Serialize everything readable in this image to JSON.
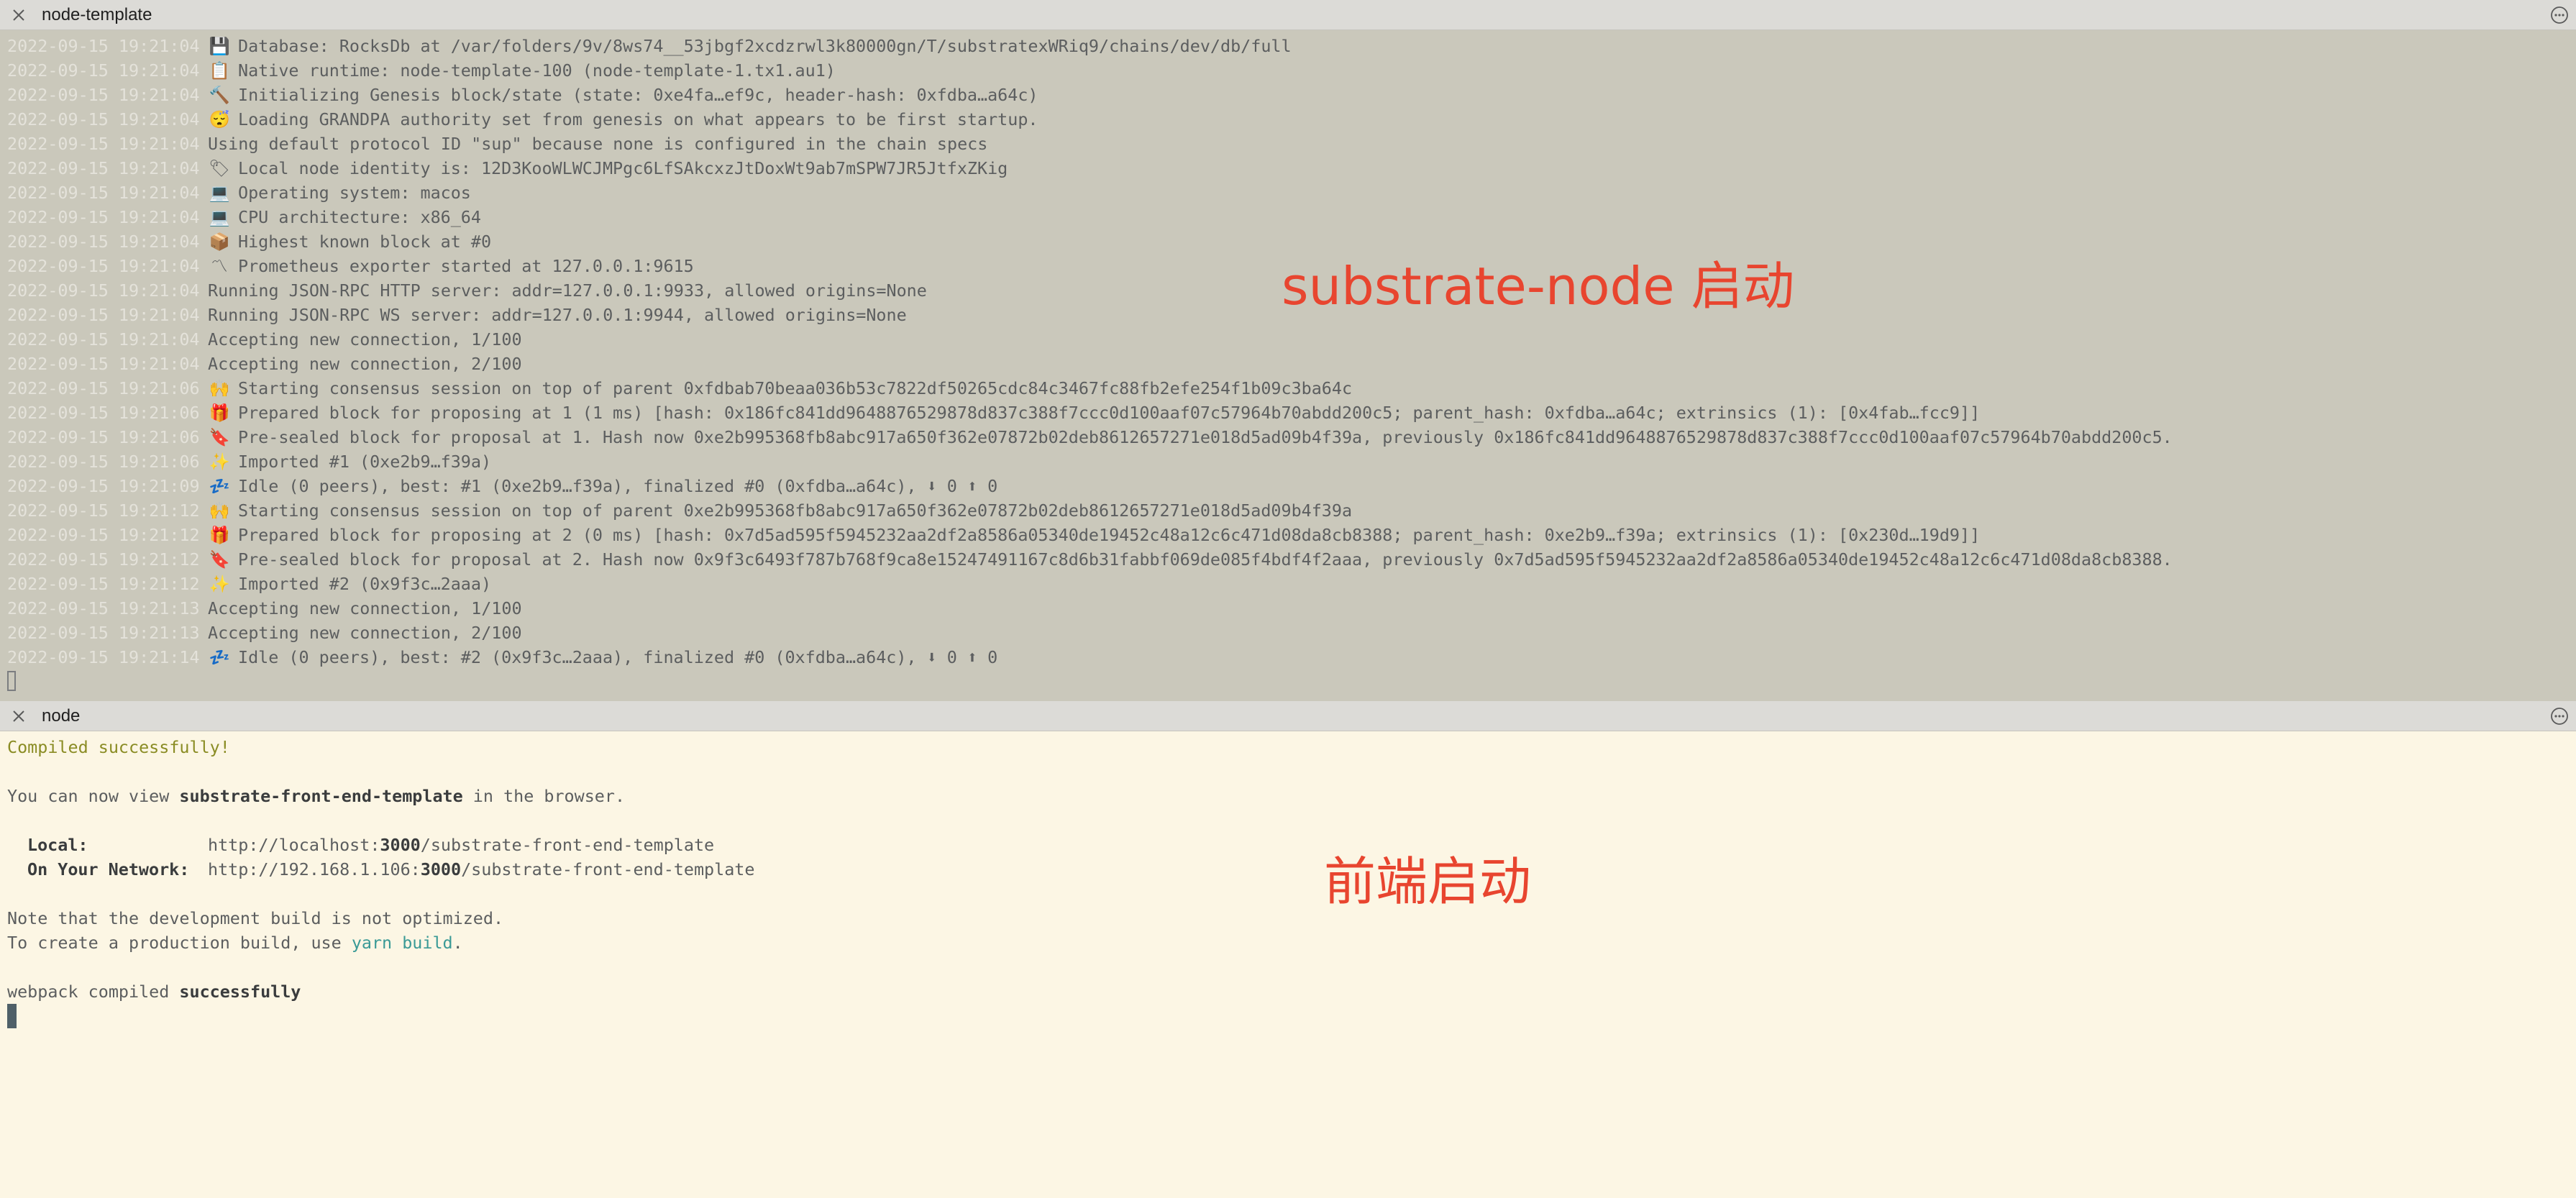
{
  "top_tab": {
    "title": "node-template"
  },
  "bottom_tab": {
    "title": "node"
  },
  "top_log": [
    {
      "ts": "2022-09-15 19:21:04",
      "icon": "💾",
      "msg": "Database: RocksDb at /var/folders/9v/8ws74__53jbgf2xcdzrwl3k80000gn/T/substratexWRiq9/chains/dev/db/full"
    },
    {
      "ts": "2022-09-15 19:21:04",
      "icon": "📋",
      "msg": "Native runtime: node-template-100 (node-template-1.tx1.au1)"
    },
    {
      "ts": "2022-09-15 19:21:04",
      "icon": "🔨",
      "msg": "Initializing Genesis block/state (state: 0xe4fa…ef9c, header-hash: 0xfdba…a64c)"
    },
    {
      "ts": "2022-09-15 19:21:04",
      "icon": "😴",
      "msg": "Loading GRANDPA authority set from genesis on what appears to be first startup."
    },
    {
      "ts": "2022-09-15 19:21:04",
      "icon": "",
      "msg": "Using default protocol ID \"sup\" because none is configured in the chain specs"
    },
    {
      "ts": "2022-09-15 19:21:04",
      "icon": "🏷",
      "msg": "Local node identity is: 12D3KooWLWCJMPgc6LfSAkcxzJtDoxWt9ab7mSPW7JR5JtfxZKig"
    },
    {
      "ts": "2022-09-15 19:21:04",
      "icon": "💻",
      "msg": "Operating system: macos"
    },
    {
      "ts": "2022-09-15 19:21:04",
      "icon": "💻",
      "msg": "CPU architecture: x86_64"
    },
    {
      "ts": "2022-09-15 19:21:04",
      "icon": "📦",
      "msg": "Highest known block at #0"
    },
    {
      "ts": "2022-09-15 19:21:04",
      "icon": "〽",
      "msg": "Prometheus exporter started at 127.0.0.1:9615"
    },
    {
      "ts": "2022-09-15 19:21:04",
      "icon": "",
      "msg": "Running JSON-RPC HTTP server: addr=127.0.0.1:9933, allowed origins=None"
    },
    {
      "ts": "2022-09-15 19:21:04",
      "icon": "",
      "msg": "Running JSON-RPC WS server: addr=127.0.0.1:9944, allowed origins=None"
    },
    {
      "ts": "2022-09-15 19:21:04",
      "icon": "",
      "msg": "Accepting new connection, 1/100"
    },
    {
      "ts": "2022-09-15 19:21:04",
      "icon": "",
      "msg": "Accepting new connection, 2/100"
    },
    {
      "ts": "2022-09-15 19:21:06",
      "icon": "🙌",
      "msg": "Starting consensus session on top of parent 0xfdbab70beaa036b53c7822df50265cdc84c3467fc88fb2efe254f1b09c3ba64c"
    },
    {
      "ts": "2022-09-15 19:21:06",
      "icon": "🎁",
      "msg": "Prepared block for proposing at 1 (1 ms) [hash: 0x186fc841dd9648876529878d837c388f7ccc0d100aaf07c57964b70abdd200c5; parent_hash: 0xfdba…a64c; extrinsics (1): [0x4fab…fcc9]]"
    },
    {
      "ts": "2022-09-15 19:21:06",
      "icon": "🔖",
      "msg": "Pre-sealed block for proposal at 1. Hash now 0xe2b995368fb8abc917a650f362e07872b02deb8612657271e018d5ad09b4f39a, previously 0x186fc841dd9648876529878d837c388f7ccc0d100aaf07c57964b70abdd200c5."
    },
    {
      "ts": "2022-09-15 19:21:06",
      "icon": "✨",
      "msg": "Imported #1 (0xe2b9…f39a)"
    },
    {
      "ts": "2022-09-15 19:21:09",
      "icon": "💤",
      "msg": "Idle (0 peers), best: #1 (0xe2b9…f39a), finalized #0 (0xfdba…a64c), ⬇ 0 ⬆ 0"
    },
    {
      "ts": "2022-09-15 19:21:12",
      "icon": "🙌",
      "msg": "Starting consensus session on top of parent 0xe2b995368fb8abc917a650f362e07872b02deb8612657271e018d5ad09b4f39a"
    },
    {
      "ts": "2022-09-15 19:21:12",
      "icon": "🎁",
      "msg": "Prepared block for proposing at 2 (0 ms) [hash: 0x7d5ad595f5945232aa2df2a8586a05340de19452c48a12c6c471d08da8cb8388; parent_hash: 0xe2b9…f39a; extrinsics (1): [0x230d…19d9]]"
    },
    {
      "ts": "2022-09-15 19:21:12",
      "icon": "🔖",
      "msg": "Pre-sealed block for proposal at 2. Hash now 0x9f3c6493f787b768f9ca8e15247491167c8d6b31fabbf069de085f4bdf4f2aaa, previously 0x7d5ad595f5945232aa2df2a8586a05340de19452c48a12c6c471d08da8cb8388."
    },
    {
      "ts": "2022-09-15 19:21:12",
      "icon": "✨",
      "msg": "Imported #2 (0x9f3c…2aaa)"
    },
    {
      "ts": "2022-09-15 19:21:13",
      "icon": "",
      "msg": "Accepting new connection, 1/100"
    },
    {
      "ts": "2022-09-15 19:21:13",
      "icon": "",
      "msg": "Accepting new connection, 2/100"
    },
    {
      "ts": "2022-09-15 19:21:14",
      "icon": "💤",
      "msg": "Idle (0 peers), best: #2 (0x9f3c…2aaa), finalized #0 (0xfdba…a64c), ⬇ 0 ⬆ 0"
    }
  ],
  "annotations": {
    "top": "substrate-node 启动",
    "bottom": "前端启动"
  },
  "bottom_log": {
    "compiled": "Compiled successfully!",
    "view_prefix": "You can now view ",
    "view_app": "substrate-front-end-template",
    "view_suffix": " in the browser.",
    "local_label": "Local:",
    "local_url_prefix": "http://localhost:",
    "local_port": "3000",
    "local_url_suffix": "/substrate-front-end-template",
    "network_label": "On Your Network:",
    "network_url_prefix": "http://192.168.1.106:",
    "network_port": "3000",
    "network_url_suffix": "/substrate-front-end-template",
    "note": "Note that the development build is not optimized.",
    "prod_prefix": "To create a production build, use ",
    "prod_cmd": "yarn build",
    "prod_suffix": ".",
    "webpack_prefix": "webpack compiled ",
    "webpack_status": "successfully"
  },
  "colors": {
    "top_pane_bg": "#cac8bb",
    "bottom_pane_bg": "#fcf6e4",
    "annotation": "#e8452f",
    "success_green": "#8a8c24",
    "command_teal": "#3a9a96"
  }
}
